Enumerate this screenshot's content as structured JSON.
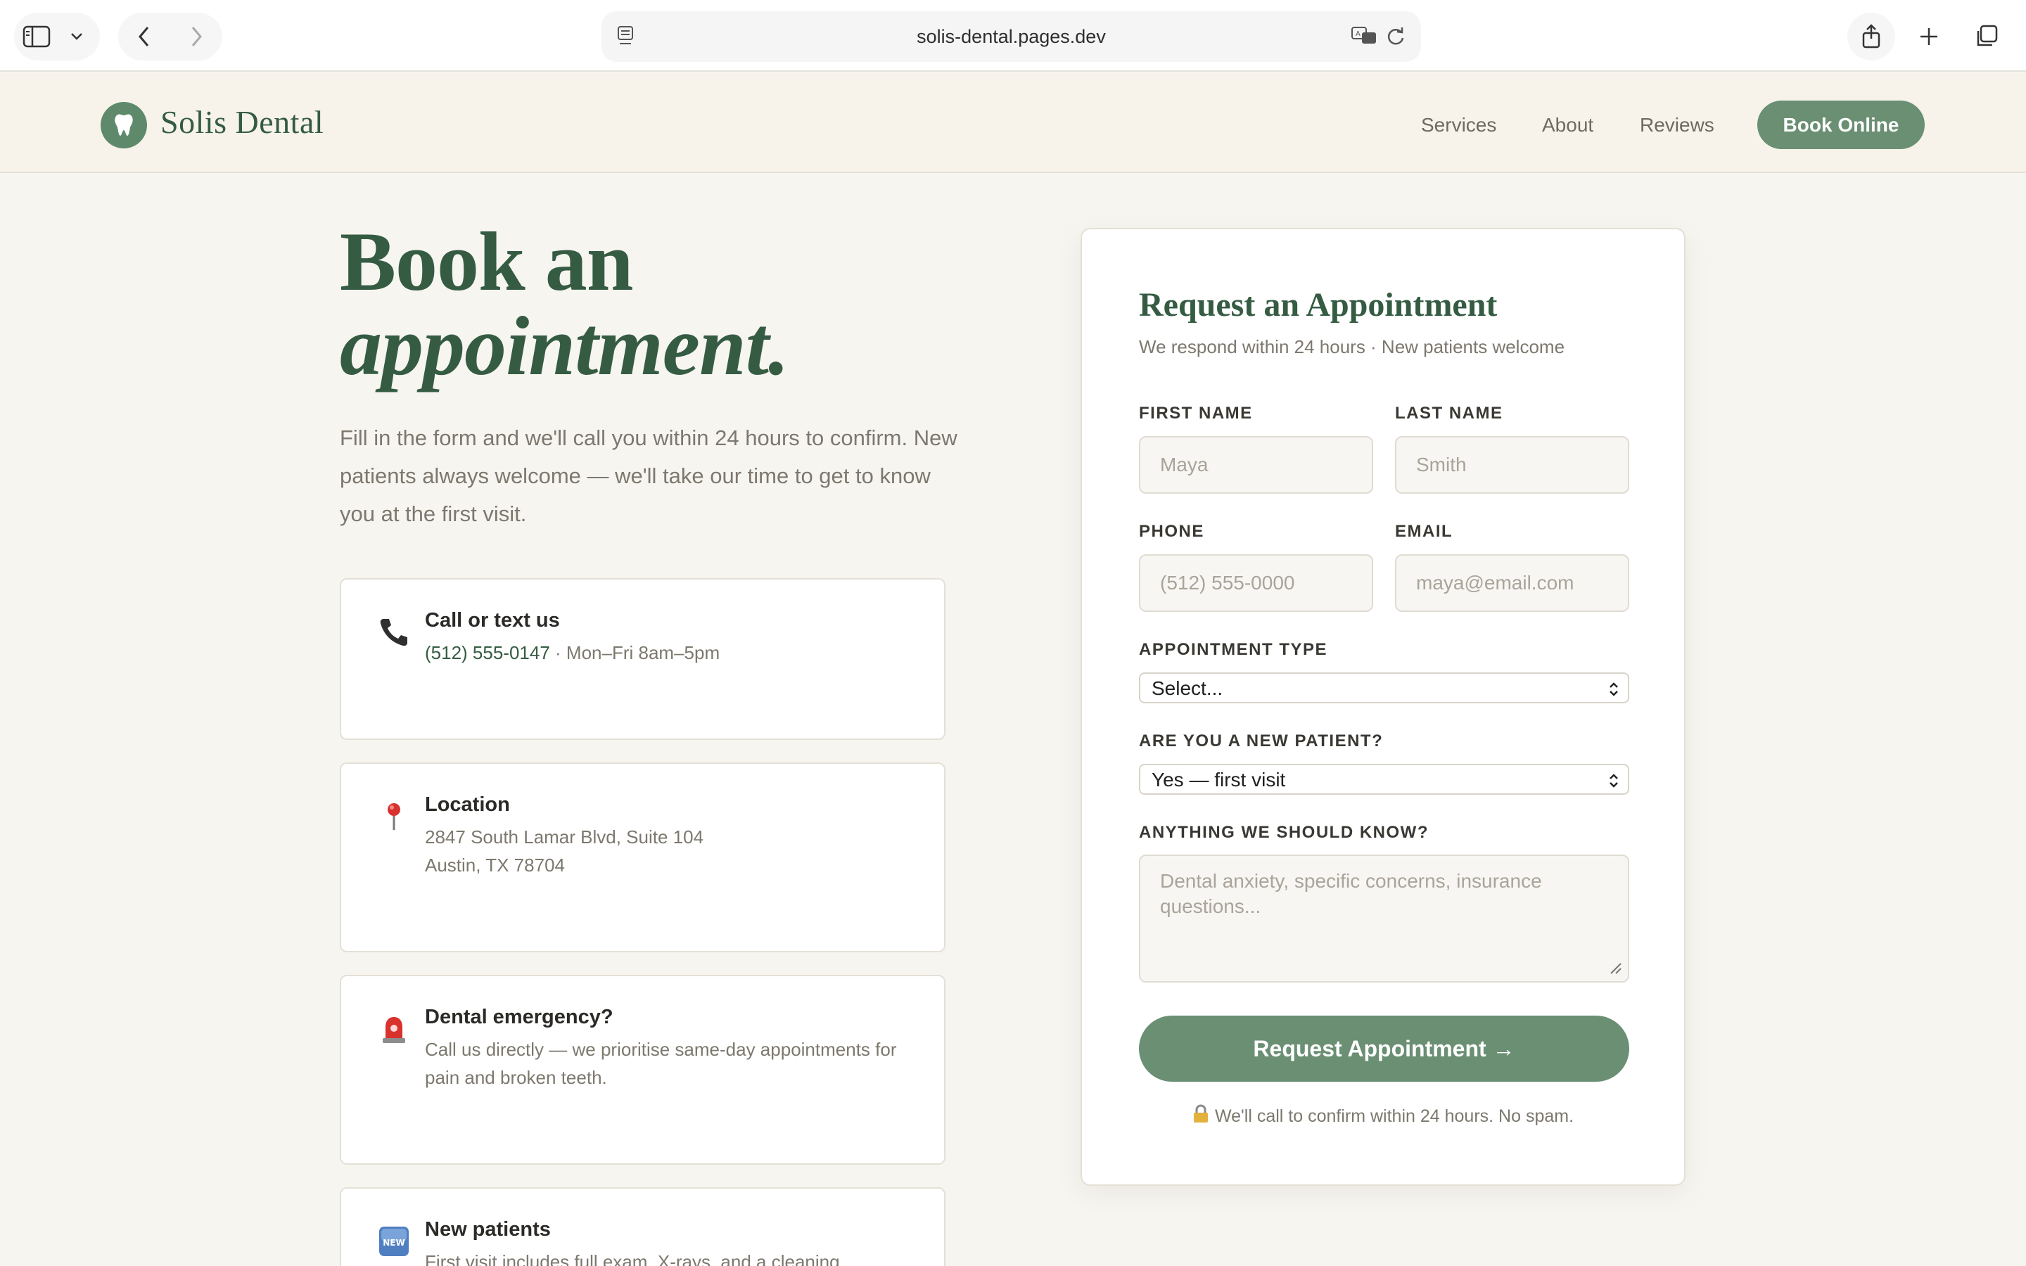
{
  "browser": {
    "url": "solis-dental.pages.dev"
  },
  "header": {
    "brand": "Solis Dental",
    "nav": [
      {
        "label": "Services"
      },
      {
        "label": "About"
      },
      {
        "label": "Reviews"
      }
    ],
    "cta_label": "Book Online"
  },
  "hero": {
    "title_line1": "Book an",
    "title_line2": "appointment.",
    "text": "Fill in the form and we'll call you within 24 hours to confirm. New patients always welcome — we'll take our time to get to know you at the first visit."
  },
  "info_cards": [
    {
      "icon": "phone-icon",
      "title": "Call or text us",
      "phone": "(512) 555-0147",
      "detail": " · Mon–Fri 8am–5pm"
    },
    {
      "icon": "location-pin-icon",
      "title": "Location",
      "line1": "2847 South Lamar Blvd, Suite 104",
      "line2": "Austin, TX 78704"
    },
    {
      "icon": "siren-icon",
      "title": "Dental emergency?",
      "body": "Call us directly — we prioritise same-day appointments for pain and broken teeth."
    },
    {
      "icon": "new-badge-icon",
      "title": "New patients",
      "body": "First visit includes full exam, X-rays, and a cleaning."
    }
  ],
  "form": {
    "title": "Request an Appointment",
    "subtitle": "We respond within 24 hours · New patients welcome",
    "first_name": {
      "label": "FIRST NAME",
      "placeholder": "Maya",
      "value": ""
    },
    "last_name": {
      "label": "LAST NAME",
      "placeholder": "Smith",
      "value": ""
    },
    "phone": {
      "label": "PHONE",
      "placeholder": "(512) 555-0000",
      "value": ""
    },
    "email": {
      "label": "EMAIL",
      "placeholder": "maya@email.com",
      "value": ""
    },
    "appointment_type": {
      "label": "APPOINTMENT TYPE",
      "selected": "Select..."
    },
    "new_patient": {
      "label": "ARE YOU A NEW PATIENT?",
      "selected": "Yes — first visit"
    },
    "notes": {
      "label": "ANYTHING WE SHOULD KNOW?",
      "placeholder": "Dental anxiety, specific concerns, insurance questions..."
    },
    "submit_label": "Request Appointment →",
    "footnote": "We'll call to confirm within 24 hours. No spam."
  },
  "colors": {
    "brand_green": "#355c43",
    "button_green": "#6a8f73",
    "page_bg": "#f7f5f0"
  }
}
